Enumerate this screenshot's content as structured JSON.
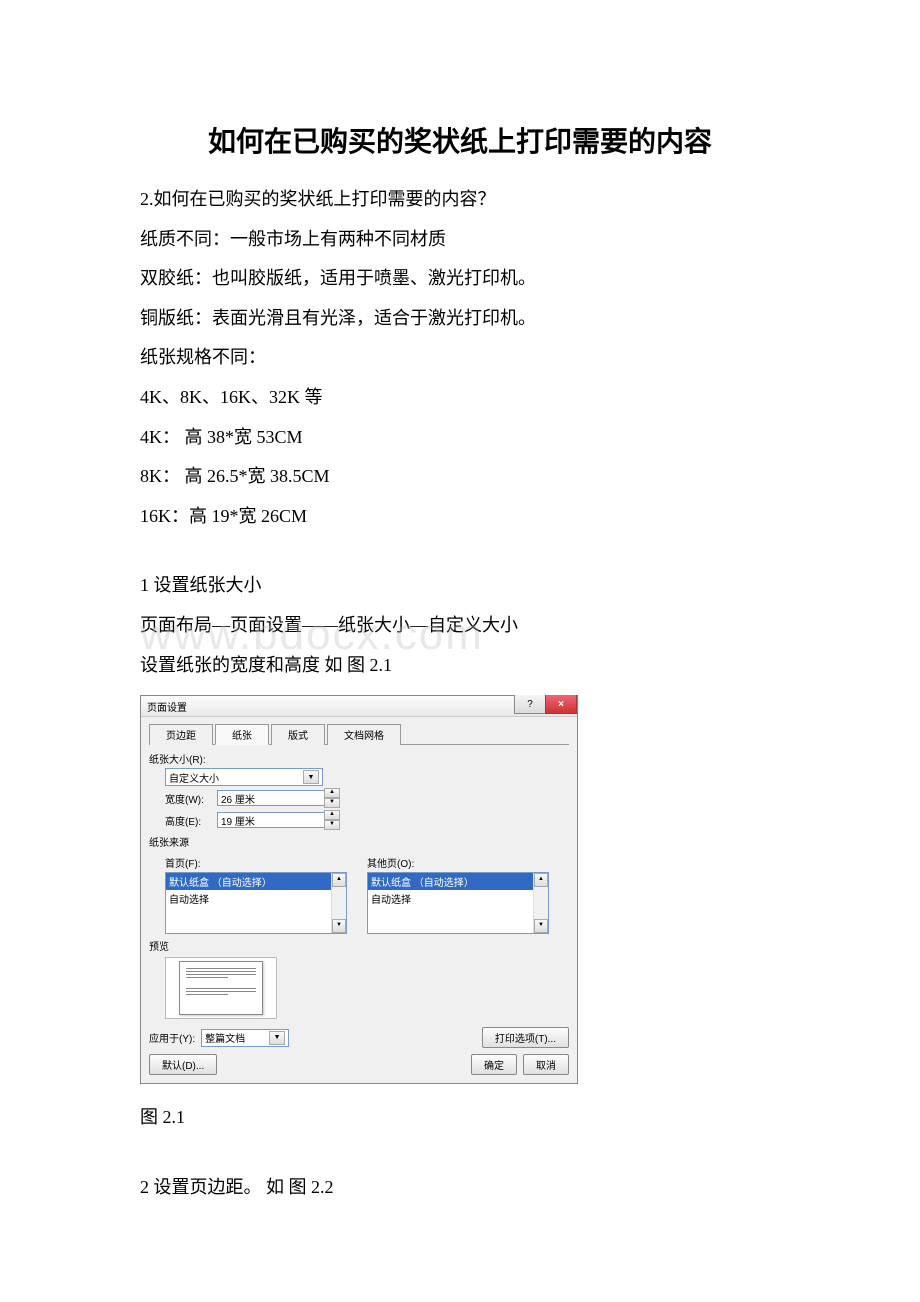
{
  "title": "如何在已购买的奖状纸上打印需要的内容",
  "paragraphs": {
    "q": "2.如何在已购买的奖状纸上打印需要的内容？",
    "p1": "纸质不同：一般市场上有两种不同材质",
    "p2": "双胶纸：也叫胶版纸，适用于喷墨、激光打印机。",
    "p3": "铜版纸：表面光滑且有光泽，适合于激光打印机。",
    "p4": "纸张规格不同：",
    "p5": "4K、8K、16K、32K 等",
    "p6": "4K： 高 38*宽 53CM",
    "p7": "8K： 高 26.5*宽 38.5CM",
    "p8": "16K：高 19*宽 26CM",
    "s1": "1 设置纸张大小",
    "s2": "页面布局—页面设置——纸张大小—自定义大小",
    "s3": "设置纸张的宽度和高度 如 图 2.1",
    "caption1": "图 2.1",
    "s4": "2 设置页边距。 如 图 2.2"
  },
  "watermark": "www.bdocx.com",
  "dialog": {
    "title": "页面设置",
    "help_icon": "?",
    "close_icon": "×",
    "tabs": {
      "margin": "页边距",
      "paper": "纸张",
      "layout": "版式",
      "grid": "文档网格"
    },
    "paper_size_label": "纸张大小(R):",
    "paper_size_value": "自定义大小",
    "width_label": "宽度(W):",
    "width_value": "26 厘米",
    "height_label": "高度(E):",
    "height_value": "19 厘米",
    "source_label": "纸张来源",
    "first_page_label": "首页(F):",
    "other_page_label": "其他页(O):",
    "tray_default": "默认纸盒 （自动选择）",
    "tray_auto": "自动选择",
    "preview_label": "预览",
    "apply_label": "应用于(Y):",
    "apply_value": "整篇文档",
    "print_options": "打印选项(T)...",
    "default_btn": "默认(D)...",
    "ok_btn": "确定",
    "cancel_btn": "取消"
  }
}
